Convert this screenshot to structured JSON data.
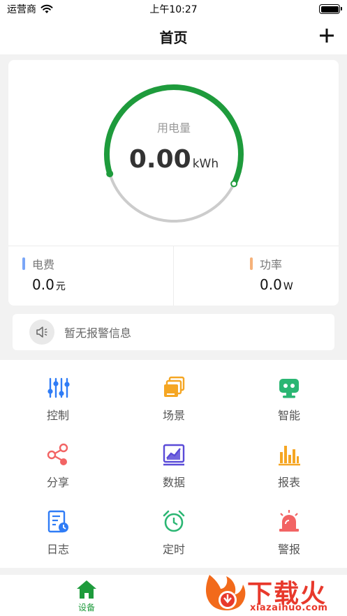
{
  "status_bar": {
    "carrier": "运营商",
    "time": "上午10:27"
  },
  "nav": {
    "title": "首页"
  },
  "energy": {
    "gauge_label": "用电量",
    "value": "0.00",
    "unit": "kWh",
    "progress": 0.62,
    "colors": {
      "accent": "#1e9b3c",
      "track": "#cccccc"
    }
  },
  "stats": {
    "fee": {
      "label": "电费",
      "value": "0.0",
      "unit": "元",
      "color": "#7aa6f7"
    },
    "power": {
      "label": "功率",
      "value": "0.0",
      "unit": "W",
      "color": "#f6b27a"
    }
  },
  "alert": {
    "text": "暂无报警信息",
    "icon": "speaker-icon"
  },
  "features": [
    {
      "label": "控制",
      "icon": "sliders-icon",
      "color": "#2f7cf6"
    },
    {
      "label": "场景",
      "icon": "layers-icon",
      "color": "#f5a623"
    },
    {
      "label": "智能",
      "icon": "robot-icon",
      "color": "#2bb673"
    },
    {
      "label": "分享",
      "icon": "share-icon",
      "color": "#f26464"
    },
    {
      "label": "数据",
      "icon": "chart-monitor-icon",
      "color": "#5a4bd8"
    },
    {
      "label": "报表",
      "icon": "bar-chart-icon",
      "color": "#f5a623"
    },
    {
      "label": "日志",
      "icon": "log-icon",
      "color": "#2f7cf6"
    },
    {
      "label": "定时",
      "icon": "alarm-clock-icon",
      "color": "#2bb673"
    },
    {
      "label": "警报",
      "icon": "siren-icon",
      "color": "#f26464"
    }
  ],
  "tab_bar": {
    "home_label": "设备"
  },
  "watermark": {
    "title": "下载火",
    "domain": "xiazaihuo.com"
  }
}
